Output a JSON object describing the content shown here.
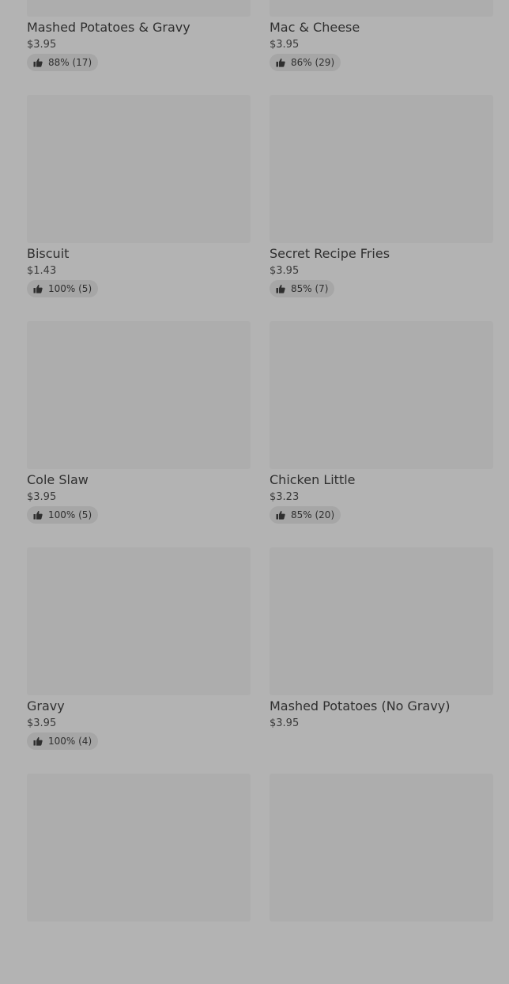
{
  "menu": {
    "items": [
      {
        "name": "Mashed Potatoes & Gravy",
        "price": "$3.95",
        "rating": "88% (17)"
      },
      {
        "name": "Mac & Cheese",
        "price": "$3.95",
        "rating": "86% (29)"
      },
      {
        "name": "Biscuit",
        "price": "$1.43",
        "rating": "100% (5)"
      },
      {
        "name": "Secret Recipe Fries",
        "price": "$3.95",
        "rating": "85% (7)"
      },
      {
        "name": "Cole Slaw",
        "price": "$3.95",
        "rating": "100% (5)"
      },
      {
        "name": "Chicken Little",
        "price": "$3.23",
        "rating": "85% (20)"
      },
      {
        "name": "Gravy",
        "price": "$3.95",
        "rating": "100% (4)"
      },
      {
        "name": "Mashed Potatoes (No Gravy)",
        "price": "$3.95",
        "rating": null
      },
      {
        "name": "",
        "price": "",
        "rating": null
      },
      {
        "name": "",
        "price": "",
        "rating": null
      }
    ]
  },
  "icons": {
    "rating": "thumbs-up-icon"
  }
}
